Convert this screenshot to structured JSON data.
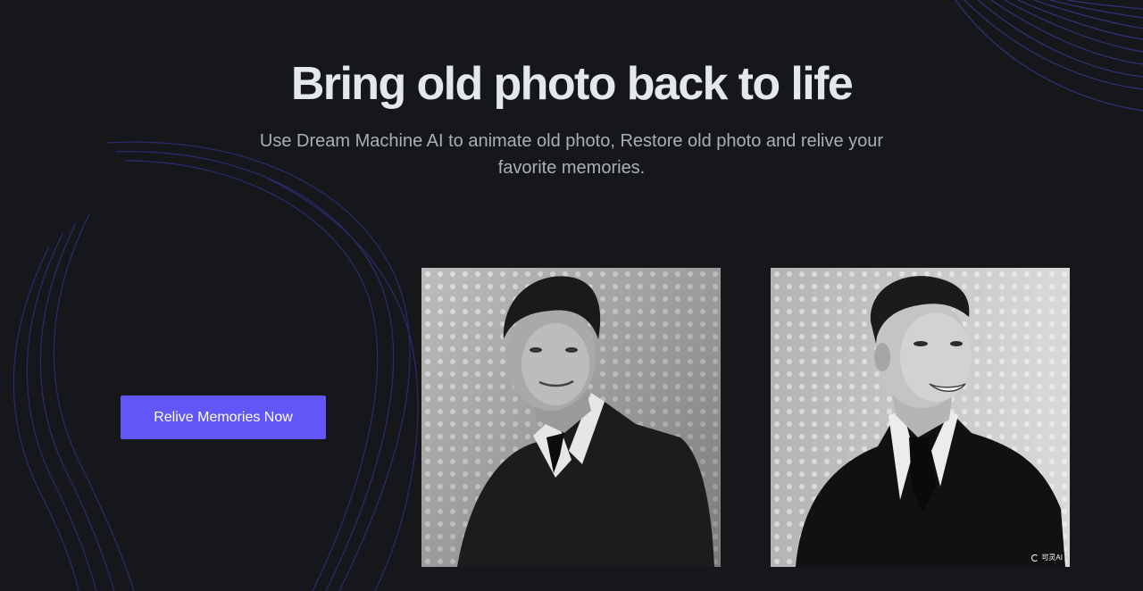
{
  "hero": {
    "title": "Bring old photo back to life",
    "subtitle": "Use Dream Machine AI to animate old photo, Restore old photo and relive your favorite memories."
  },
  "cta": {
    "label": "Relive Memories Now"
  },
  "photos": {
    "before": {
      "description_icon": "old-photo-original"
    },
    "after": {
      "description_icon": "old-photo-animated",
      "watermark": "可灵AI"
    }
  },
  "colors": {
    "background": "#16171b",
    "accent": "#6356f7",
    "title": "#e4e8ee",
    "subtitle": "#a9b0ba",
    "decor_lines": "#3d3a8c"
  }
}
